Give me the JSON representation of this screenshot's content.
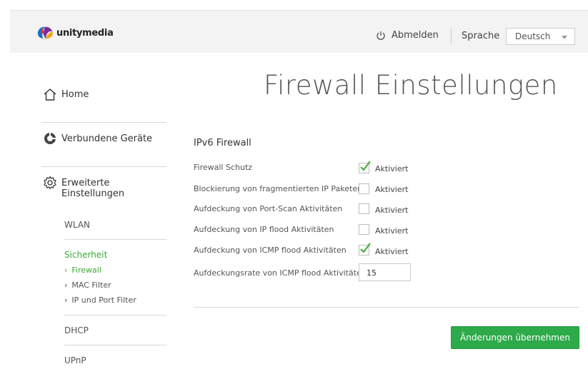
{
  "header": {
    "brand": "unitymedia",
    "logout_label": "Abmelden",
    "language_label": "Sprache",
    "language_selected": "Deutsch"
  },
  "sidebar": {
    "home": "Home",
    "connected_devices": "Verbundene Geräte",
    "advanced_settings": "Erweiterte Einstellungen",
    "sub": {
      "wlan": "WLAN",
      "security": "Sicherheit",
      "security_items": [
        "Firewall",
        "MAC Filter",
        "IP und Port Filter"
      ],
      "dhcp": "DHCP",
      "upnp": "UPnP"
    }
  },
  "main": {
    "title": "Firewall Einstellungen",
    "section_title": "IPv6 Firewall",
    "rows": [
      {
        "label": "Firewall Schutz",
        "checked": true,
        "status": "Aktiviert"
      },
      {
        "label": "Blockierung von fragmentierten IP Paketen",
        "checked": false,
        "status": "Aktiviert"
      },
      {
        "label": "Aufdeckung von Port-Scan Aktivitäten",
        "checked": false,
        "status": "Aktiviert"
      },
      {
        "label": "Aufdeckung von IP flood Aktivitäten",
        "checked": false,
        "status": "Aktiviert"
      },
      {
        "label": "Aufdeckung von ICMP flood Aktivitäten",
        "checked": true,
        "status": "Aktiviert"
      }
    ],
    "rate_label": "Aufdeckungsrate von ICMP flood Aktivitäten",
    "rate_value": "15",
    "apply_button": "Änderungen übernehmen"
  },
  "colors": {
    "accent_green": "#3aaa35",
    "button_green": "#2daa4a"
  }
}
